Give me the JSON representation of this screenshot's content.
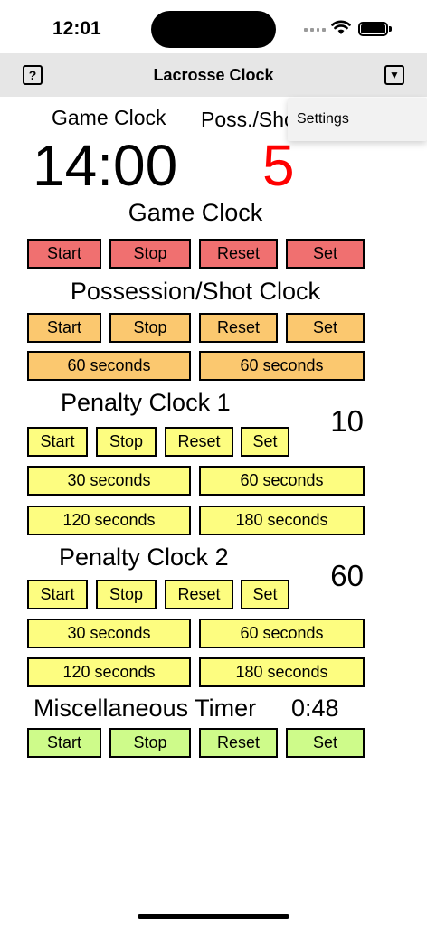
{
  "status": {
    "time": "12:01"
  },
  "nav": {
    "help_icon": "?",
    "title": "Lacrosse Clock",
    "menu_icon": "▼"
  },
  "menu": {
    "items": [
      "Settings"
    ]
  },
  "top": {
    "game_label": "Game Clock",
    "poss_label": "Poss./Shot Clock",
    "game_time": "14:00",
    "poss_time": "5"
  },
  "game_clock": {
    "title": "Game Clock",
    "buttons": [
      "Start",
      "Stop",
      "Reset",
      "Set"
    ]
  },
  "possession": {
    "title": "Possession/Shot Clock",
    "buttons": [
      "Start",
      "Stop",
      "Reset",
      "Set"
    ],
    "presets": [
      "60 seconds",
      "60 seconds"
    ]
  },
  "penalty1": {
    "title": "Penalty Clock 1",
    "value": "10",
    "buttons": [
      "Start",
      "Stop",
      "Reset",
      "Set"
    ],
    "presets": [
      "30 seconds",
      "60 seconds",
      "120 seconds",
      "180 seconds"
    ]
  },
  "penalty2": {
    "title": "Penalty Clock 2",
    "value": "60",
    "buttons": [
      "Start",
      "Stop",
      "Reset",
      "Set"
    ],
    "presets": [
      "30 seconds",
      "60 seconds",
      "120 seconds",
      "180 seconds"
    ]
  },
  "misc": {
    "title": "Miscellaneous Timer",
    "value": "0:48",
    "buttons": [
      "Start",
      "Stop",
      "Reset",
      "Set"
    ]
  },
  "colors": {
    "game": "#f07070",
    "possession": "#fbc86f",
    "penalty": "#fdfd80",
    "misc": "#cefb8a",
    "shot_value": "#ff0000"
  }
}
